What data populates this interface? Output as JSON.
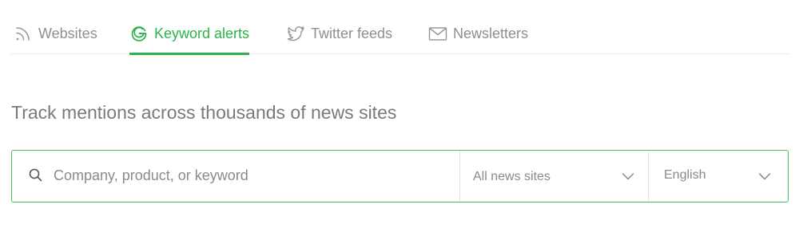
{
  "tabs": [
    {
      "label": "Websites",
      "icon": "rss-icon",
      "active": false
    },
    {
      "label": "Keyword alerts",
      "icon": "google-icon",
      "active": true
    },
    {
      "label": "Twitter feeds",
      "icon": "twitter-icon",
      "active": false
    },
    {
      "label": "Newsletters",
      "icon": "envelope-icon",
      "active": false
    }
  ],
  "heading": "Track mentions across thousands of news sites",
  "search": {
    "placeholder": "Company, product, or keyword",
    "value": "",
    "icon": "search-icon"
  },
  "sources_select": {
    "value": "All news sites",
    "icon": "chevron-down-icon"
  },
  "language_select": {
    "value": "English",
    "icon": "chevron-down-icon"
  },
  "colors": {
    "accent": "#2cb34a",
    "border": "#4cbf63",
    "muted_text": "#8f8f8f",
    "heading_text": "#7a7a7a",
    "divider": "#ececec"
  }
}
